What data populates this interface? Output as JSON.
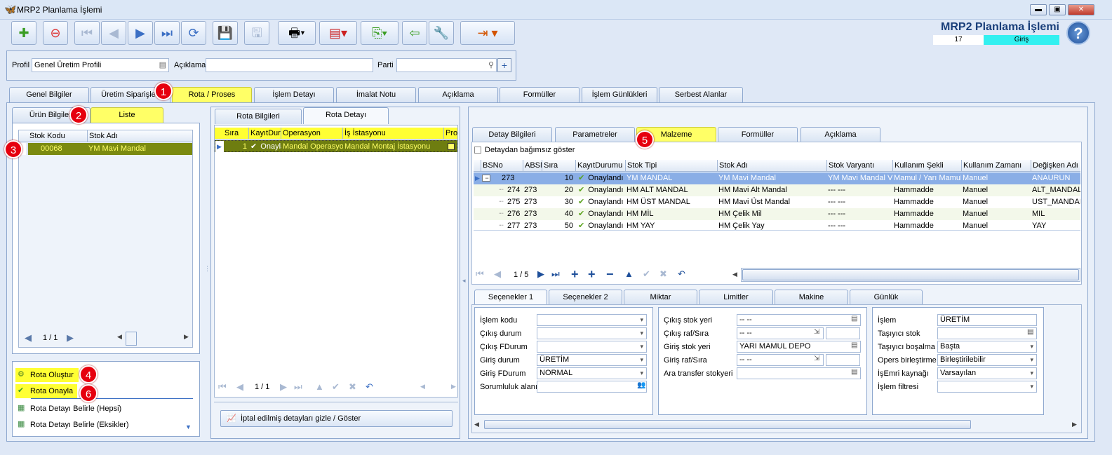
{
  "window": {
    "title": "MRP2 Planlama İşlemi",
    "min": "▬",
    "max": "▣",
    "close": "✕"
  },
  "header": {
    "title": "MRP2 Planlama İşlemi",
    "number": "17",
    "status": "Giriş",
    "help": "?"
  },
  "filters": {
    "profil_label": "Profil",
    "profil_value": "Genel Üretim Profili",
    "aciklama_label": "Açıklama",
    "aciklama_value": "",
    "parti_label": "Parti",
    "parti_value": ""
  },
  "main_tabs": [
    "Genel Bilgiler",
    "Üretim Siparişleri",
    "Rota / Proses",
    "İşlem Detayı",
    "İmalat Notu",
    "Açıklama",
    "Formüller",
    "İşlem Günlükleri",
    "Serbest Alanlar"
  ],
  "badges": [
    "1",
    "2",
    "3",
    "4",
    "5",
    "6"
  ],
  "left": {
    "tabs": [
      "Ürün Bilgileri",
      "Liste"
    ],
    "columns": [
      "Stok Kodu",
      "Stok Adı"
    ],
    "rows": [
      {
        "kod": "00068",
        "ad": "YM Mavi Mandal"
      }
    ],
    "pager": "1 / 1"
  },
  "actions": [
    "Rota Oluştur",
    "Rota Onayla",
    "Rota Detayı Belirle (Hepsi)",
    "Rota Detayı Belirle (Eksikler)"
  ],
  "mid": {
    "tabs": [
      "Rota Bilgileri",
      "Rota Detayı"
    ],
    "columns": [
      "Sıra",
      "KayıtDurumu",
      "Operasyon",
      "İş İstasyonu",
      "Pro"
    ],
    "rows": [
      {
        "sira": "1",
        "durum": "Onaylandı",
        "op": "Mandal Operasyonu",
        "ist": "Mandal Montaj İstasyonu"
      }
    ],
    "pager": "1 / 1",
    "toggle_button": "İptal edilmiş detayları gizle / Göster"
  },
  "right": {
    "tabs": [
      "Detay Bilgileri",
      "Parametreler",
      "Malzeme",
      "Formüller",
      "Açıklama"
    ],
    "checkbox": "Detaydan bağımsız göster",
    "columns": [
      "BSNo",
      "ABSNo",
      "Sıra",
      "KayıtDurumu",
      "Stok Tipi",
      "Stok Adı",
      "Stok Varyantı",
      "Kullanım Şekli",
      "Kullanım Zamanı",
      "Değişken Adı"
    ],
    "rows": [
      {
        "bs": "273",
        "abs": "",
        "sira": "10",
        "durum": "Onaylandı",
        "tip": "YM MANDAL",
        "ad": "YM Mavi Mandal",
        "var": "YM Mavi Mandal Va",
        "sekil": "Mamul / Yarı Mamul",
        "zaman": "Manuel",
        "deg": "ANAURUN"
      },
      {
        "bs": "274",
        "abs": "273",
        "sira": "20",
        "durum": "Onaylandı",
        "tip": "HM ALT MANDAL",
        "ad": "HM Mavi Alt Mandal",
        "var": "--- ---",
        "sekil": "Hammadde",
        "zaman": "Manuel",
        "deg": "ALT_MANDAL"
      },
      {
        "bs": "275",
        "abs": "273",
        "sira": "30",
        "durum": "Onaylandı",
        "tip": "HM ÜST MANDAL",
        "ad": "HM Mavi Üst Mandal",
        "var": "--- ---",
        "sekil": "Hammadde",
        "zaman": "Manuel",
        "deg": "UST_MANDAL"
      },
      {
        "bs": "276",
        "abs": "273",
        "sira": "40",
        "durum": "Onaylandı",
        "tip": "HM MİL",
        "ad": "HM Çelik Mil",
        "var": "--- ---",
        "sekil": "Hammadde",
        "zaman": "Manuel",
        "deg": "MIL"
      },
      {
        "bs": "277",
        "abs": "273",
        "sira": "50",
        "durum": "Onaylandı",
        "tip": "HM YAY",
        "ad": "HM Çelik Yay",
        "var": "--- ---",
        "sekil": "Hammadde",
        "zaman": "Manuel",
        "deg": "YAY"
      }
    ],
    "pager": "1 / 5",
    "sub_tabs": [
      "Seçenekler 1",
      "Seçenekler 2",
      "Miktar",
      "Limitler",
      "Makine",
      "Günlük"
    ],
    "col1": [
      {
        "l": "İşlem kodu",
        "v": ""
      },
      {
        "l": "Çıkış durum",
        "v": ""
      },
      {
        "l": "Çıkış FDurum",
        "v": ""
      },
      {
        "l": "Giriş durum",
        "v": "ÜRETİM"
      },
      {
        "l": "Giriş FDurum",
        "v": "NORMAL"
      },
      {
        "l": "Sorumluluk alanı",
        "v": ""
      }
    ],
    "col2": [
      {
        "l": "Çıkış stok yeri",
        "v": "-- --"
      },
      {
        "l": "Çıkış raf/Sıra",
        "v": "-- --"
      },
      {
        "l": "Giriş stok yeri",
        "v": "YARI MAMUL DEPO"
      },
      {
        "l": "Giriş raf/Sıra",
        "v": "-- --"
      },
      {
        "l": "Ara transfer stokyeri",
        "v": ""
      }
    ],
    "col3": [
      {
        "l": "İşlem",
        "v": "ÜRETİM"
      },
      {
        "l": "Taşıyıcı stok",
        "v": ""
      },
      {
        "l": "Taşıyıcı boşalma",
        "v": "Başta"
      },
      {
        "l": "Opers birleştirme",
        "v": "Birleştirilebilir"
      },
      {
        "l": "İşEmri kaynağı",
        "v": "Varsayılan"
      },
      {
        "l": "İşlem filtresi",
        "v": ""
      }
    ]
  }
}
